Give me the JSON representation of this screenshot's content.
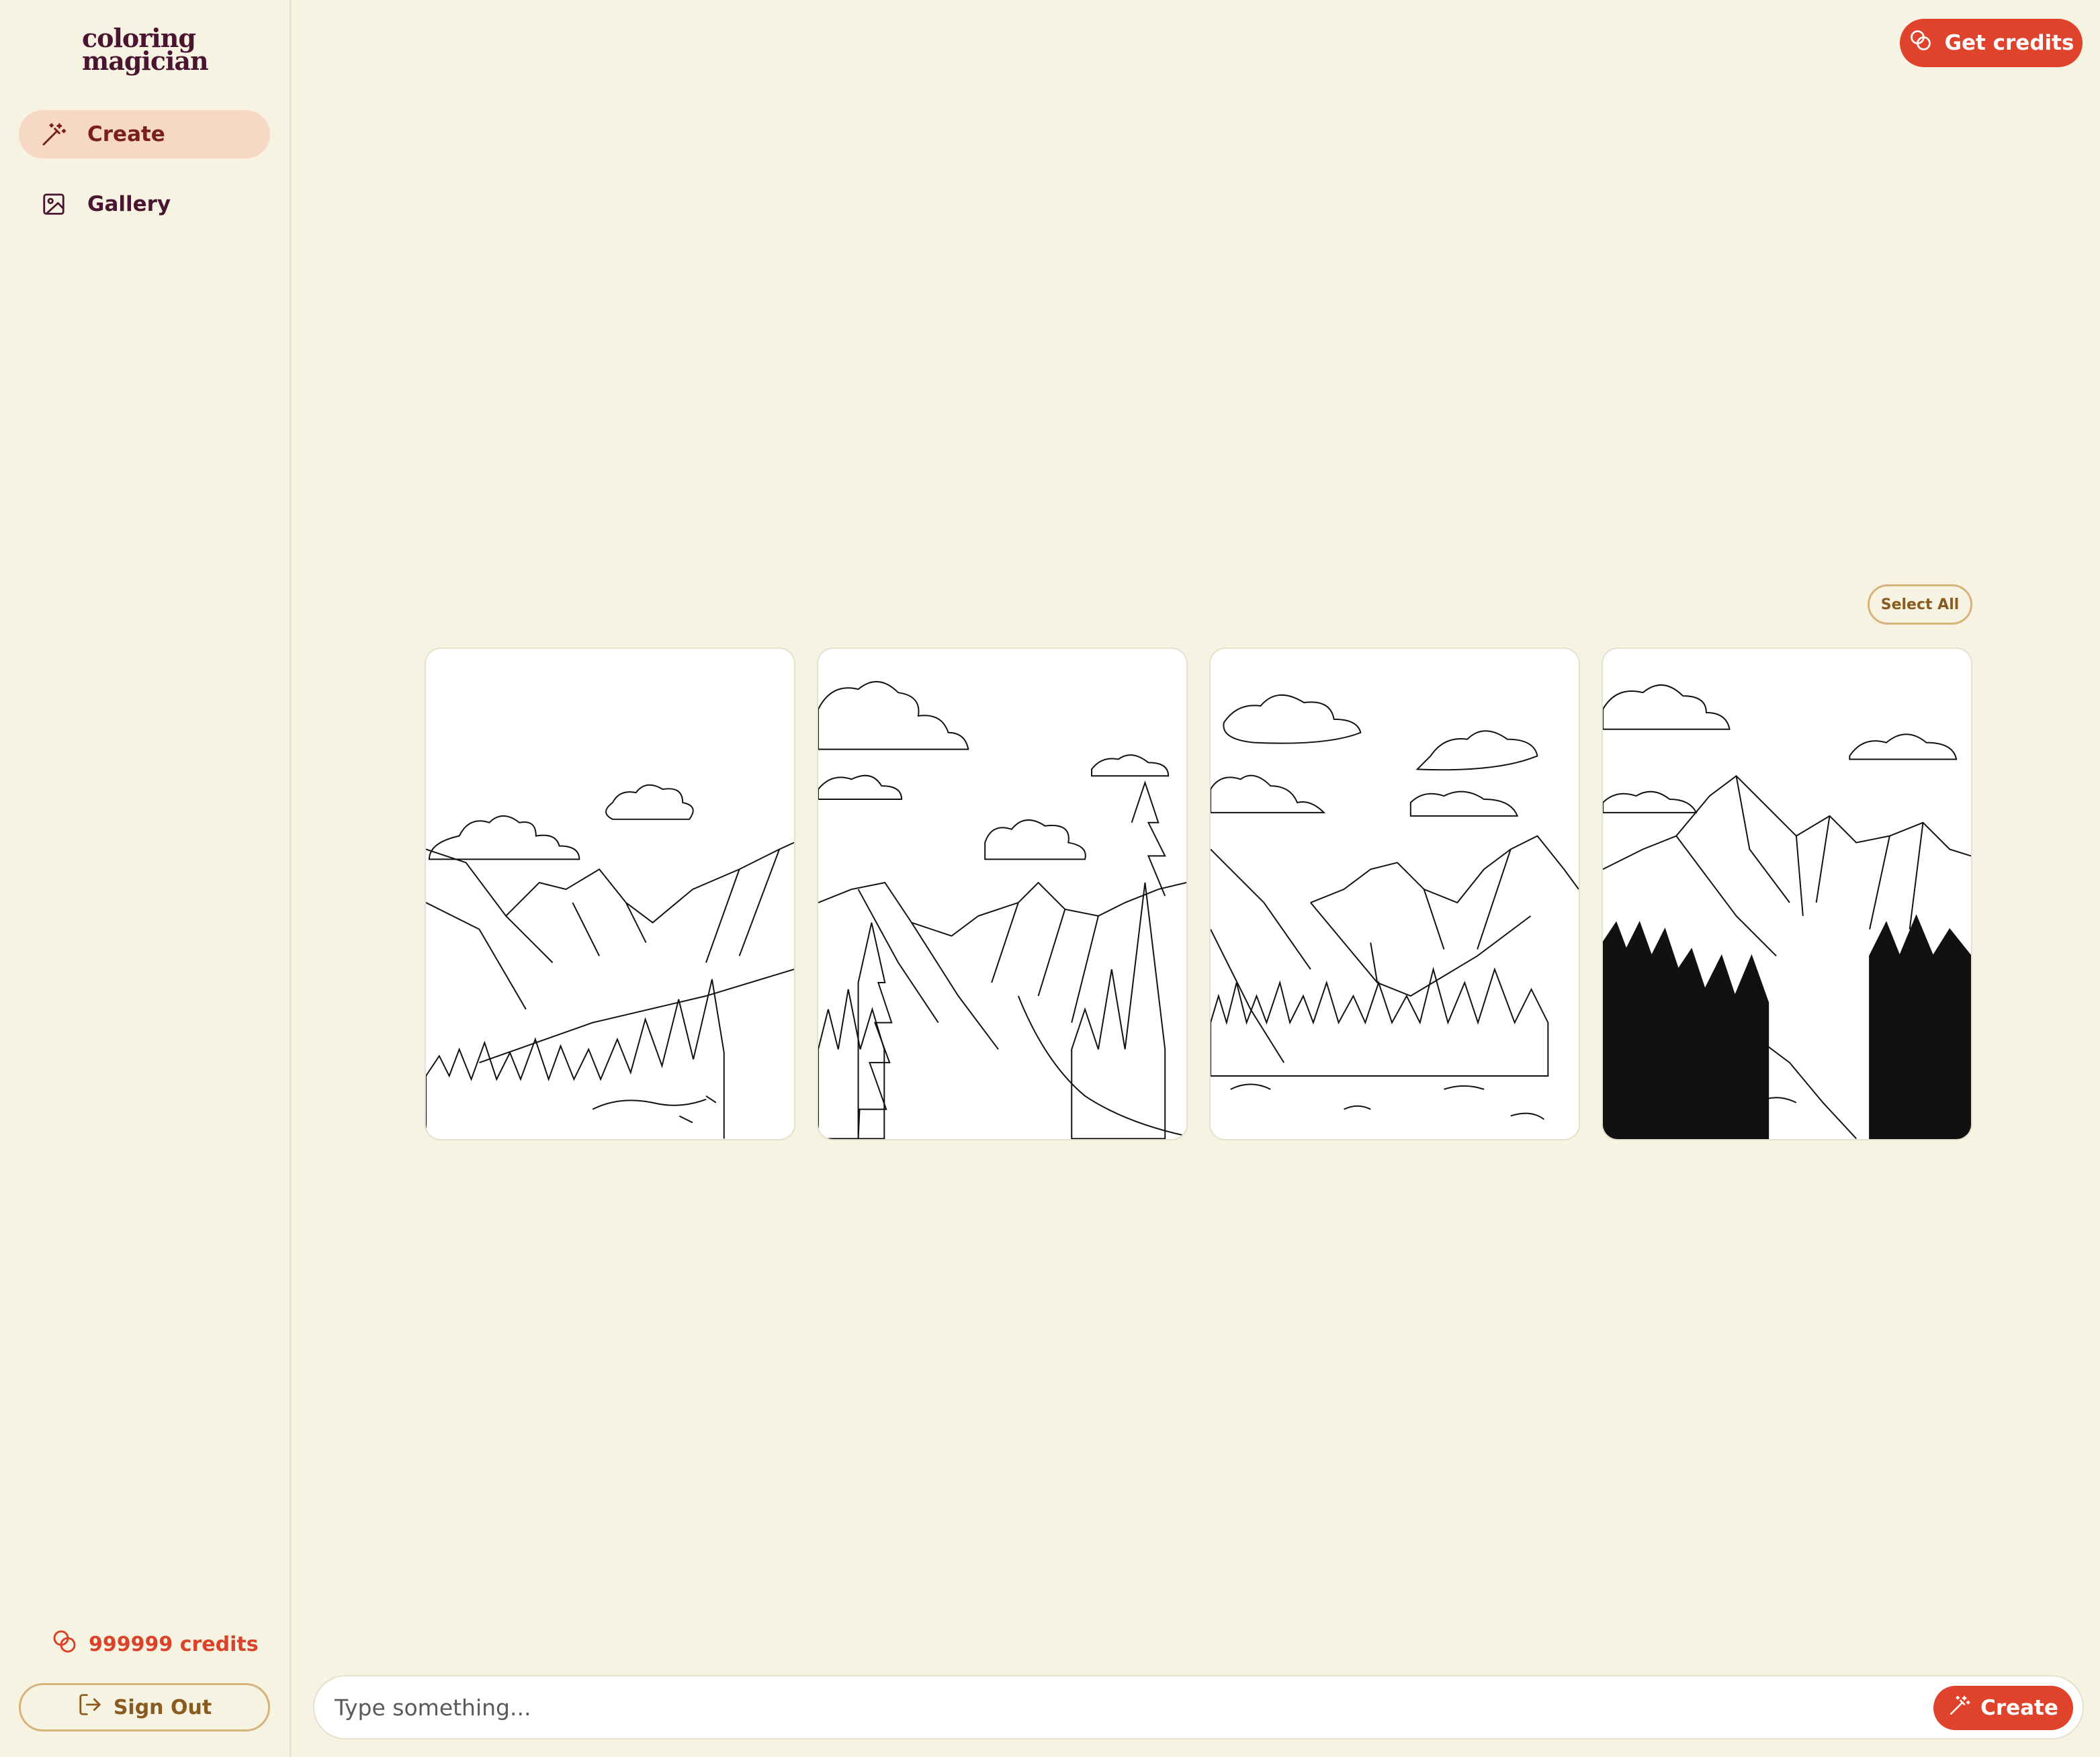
{
  "brand": {
    "line1": "coloring",
    "line2": "magician"
  },
  "sidebar": {
    "items": [
      {
        "label": "Create",
        "icon": "magic-wand-icon",
        "active": true
      },
      {
        "label": "Gallery",
        "icon": "image-icon",
        "active": false
      }
    ],
    "credits_label": "999999 credits",
    "sign_out_label": "Sign Out"
  },
  "header": {
    "get_credits_label": "Get credits"
  },
  "results": {
    "select_all_label": "Select All",
    "images": [
      {
        "subject": "mountain-landscape-coloring-page"
      },
      {
        "subject": "mountain-landscape-coloring-page"
      },
      {
        "subject": "mountain-landscape-coloring-page"
      },
      {
        "subject": "mountain-landscape-coloring-page"
      }
    ]
  },
  "prompt": {
    "placeholder": "Type something...",
    "value": "",
    "create_label": "Create"
  },
  "colors": {
    "accent": "#e0432b",
    "background": "#f7f3e3",
    "active_nav": "#f7d8c4",
    "brand_text": "#4a1530",
    "outline": "#d8b27a"
  }
}
